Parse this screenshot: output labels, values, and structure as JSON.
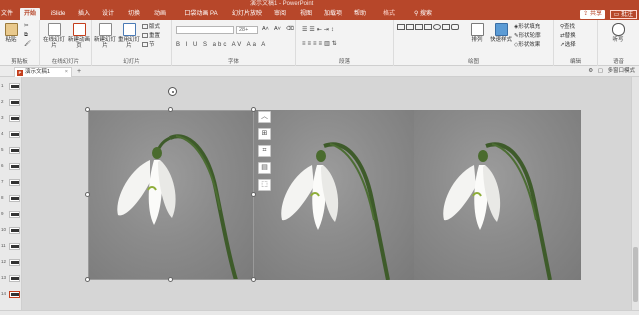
{
  "window": {
    "title": "演示文稿1 - PowerPoint"
  },
  "tabs": [
    {
      "label": "文件",
      "active": false
    },
    {
      "label": "开始",
      "active": true
    },
    {
      "label": "iSlide",
      "active": false
    },
    {
      "label": "插入",
      "active": false
    },
    {
      "label": "设计",
      "active": false
    },
    {
      "label": "切换",
      "active": false
    },
    {
      "label": "动画",
      "active": false
    },
    {
      "label": "口袋动画 PA",
      "active": false
    },
    {
      "label": "幻灯片放映",
      "active": false
    },
    {
      "label": "审阅",
      "active": false
    },
    {
      "label": "视图",
      "active": false
    },
    {
      "label": "加载项",
      "active": false
    },
    {
      "label": "帮助",
      "active": false
    },
    {
      "label": "格式",
      "active": false
    }
  ],
  "tell_me": "搜索",
  "share_label": "共享",
  "comment_label": "批注",
  "ribbon": {
    "clipboard": {
      "paste": "粘贴",
      "label": "剪贴板"
    },
    "online": {
      "online_slides": "在线幻灯片",
      "new_anim": "新建动画页",
      "label": "在线幻灯片"
    },
    "slides": {
      "new_slide": "新建幻灯片",
      "reuse": "重用幻灯片",
      "layout": "版式",
      "reset": "重置",
      "section": "节",
      "label": "幻灯片"
    },
    "font": {
      "font_name": "",
      "font_size": "28+",
      "format_row": "B I U S abc AV Aa A",
      "label": "字体"
    },
    "paragraph": {
      "label": "段落"
    },
    "drawing": {
      "arrange": "排列",
      "quick_styles": "快速样式",
      "fill": "形状填充",
      "outline": "形状轮廓",
      "effects": "形状效果",
      "label": "绘图"
    },
    "editing": {
      "find": "查找",
      "replace": "替换",
      "select": "选择",
      "label": "编辑"
    },
    "voice": {
      "dictate": "听写",
      "label": "语音"
    }
  },
  "document": {
    "tab_title": "演示文稿1",
    "add_tab": "+",
    "multi_window": "多窗口模式"
  },
  "thumbnails": [
    {
      "num": "1"
    },
    {
      "num": "2"
    },
    {
      "num": "3"
    },
    {
      "num": "4"
    },
    {
      "num": "5"
    },
    {
      "num": "6"
    },
    {
      "num": "7"
    },
    {
      "num": "8"
    },
    {
      "num": "9"
    },
    {
      "num": "10"
    },
    {
      "num": "11"
    },
    {
      "num": "12"
    },
    {
      "num": "13"
    },
    {
      "num": "14"
    }
  ],
  "floating_tools": [
    {
      "icon": "collapse-up-icon"
    },
    {
      "icon": "layout-options-icon"
    },
    {
      "icon": "crop-icon"
    },
    {
      "icon": "image-styles-icon"
    },
    {
      "icon": "alt-text-icon"
    }
  ],
  "colors": {
    "accent": "#b7472a",
    "ribbon_bg": "#f3f3f3",
    "canvas_bg": "#d6d6d6"
  }
}
